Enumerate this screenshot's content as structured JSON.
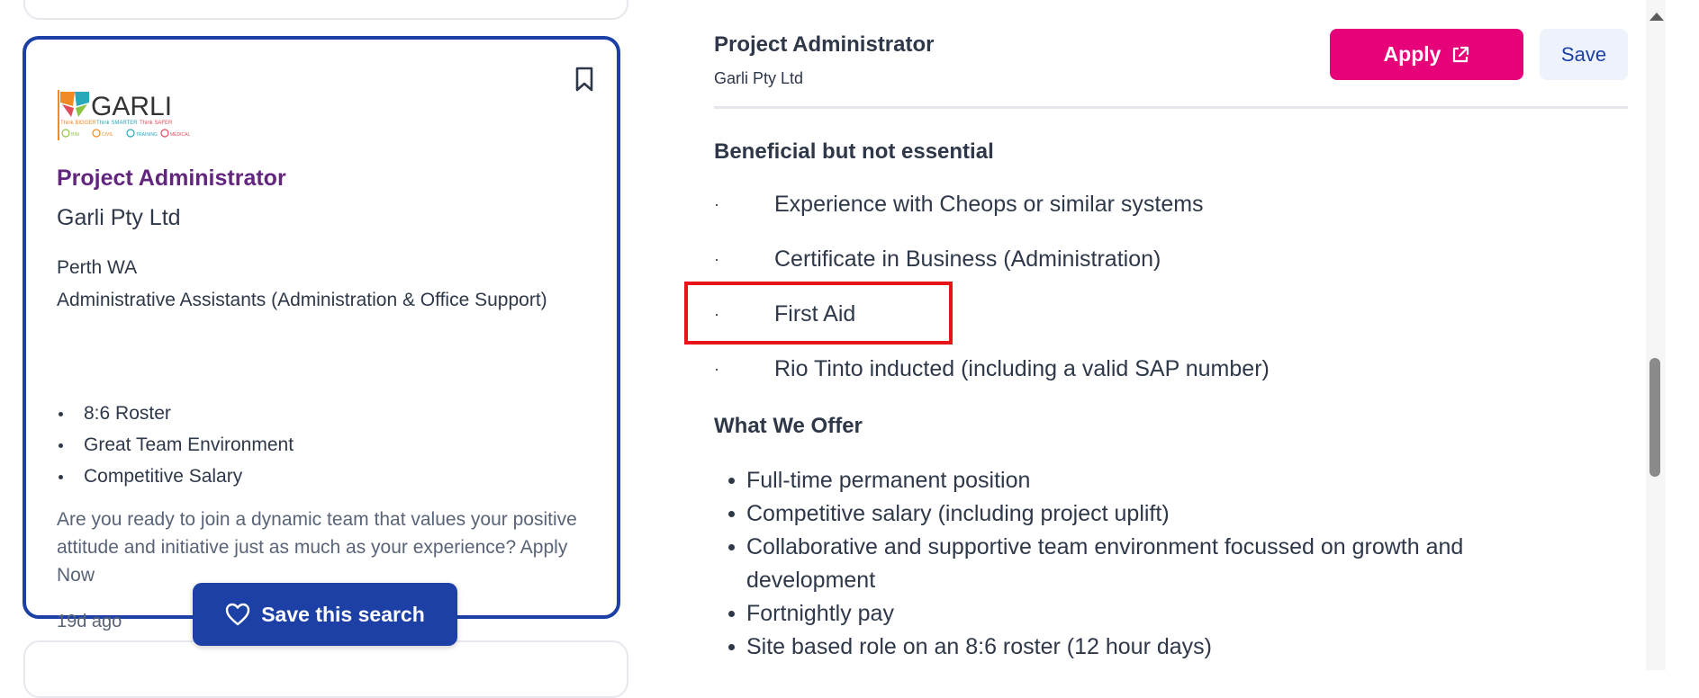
{
  "job_card": {
    "logo_text": "GARLI",
    "logo_tagline": "Think BIGGER Think SMARTER Think SAFER",
    "logo_services": [
      "BIM",
      "CIVIL",
      "TRAINING",
      "MEDICAL"
    ],
    "title": "Project Administrator",
    "company": "Garli Pty Ltd",
    "location": "Perth WA",
    "classification": "Administrative Assistants (Administration & Office Support)",
    "bullets": [
      "8:6 Roster",
      "Great Team Environment",
      "Competitive Salary"
    ],
    "teaser": "Are you ready to join a dynamic team that values your positive attitude and initiative just as much as your experience? Apply Now",
    "age": "19d ago"
  },
  "save_search": {
    "label": "Save this search",
    "icon": "heart-icon"
  },
  "detail": {
    "title": "Project Administrator",
    "company": "Garli Pty Ltd",
    "apply_label": "Apply",
    "save_label": "Save",
    "section_beneficial": "Beneficial but not essential",
    "beneficial_items": [
      "Experience with Cheops or similar systems",
      "Certificate in Business (Administration)",
      "First Aid",
      "Rio Tinto inducted (including a valid SAP number)"
    ],
    "bullet_char": "·",
    "section_offer": "What We Offer",
    "offer_items": [
      "Full-time permanent position",
      "Competitive salary (including project uplift)",
      "Collaborative and supportive team environment focussed on growth and development",
      "Fortnightly pay",
      "Site based role on an 8:6 roster (12 hour days)"
    ]
  },
  "colors": {
    "brand_blue": "#1c40a6",
    "title_purple": "#62267f",
    "apply_pink": "#e60278",
    "highlight_red": "#e8141b"
  }
}
